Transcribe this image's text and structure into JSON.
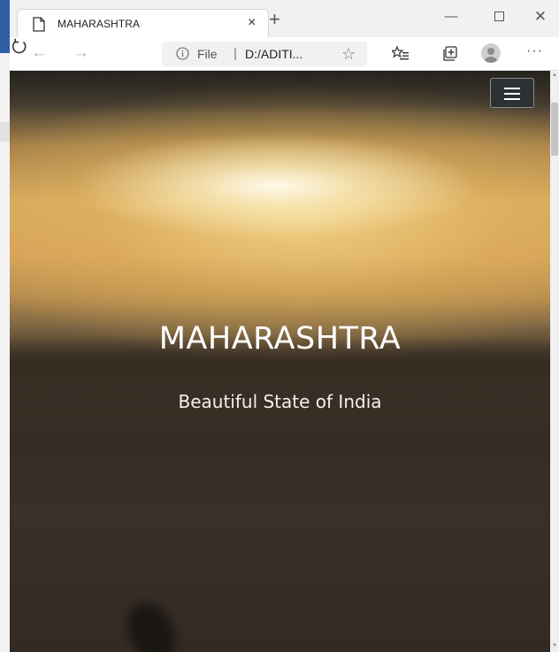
{
  "window": {
    "tab_title": "MAHARASHTRA",
    "close_tab_glyph": "×",
    "new_tab_glyph": "+",
    "minimize_glyph": "—",
    "close_window_glyph": "✕"
  },
  "addressbar": {
    "back_glyph": "←",
    "forward_glyph": "→",
    "url_scheme": "File",
    "url_separator": "|",
    "url_text": "D:/ADITI...",
    "favorite_glyph": "☆",
    "more_glyph": "···"
  },
  "hero": {
    "title": "MAHARASHTRA",
    "subtitle": "Beautiful State of India"
  },
  "icons": {
    "page": "page-icon",
    "refresh": "refresh-icon",
    "info": "info-icon",
    "favorites_list": "favorites-list-icon",
    "collections": "collections-icon",
    "profile": "profile-icon",
    "menu": "hamburger-menu-icon"
  },
  "colors": {
    "navbar_toggle_bg": "#2e3134",
    "hero_text": "#ffffff",
    "sky_highlight": "#fff6d8",
    "ground_dark": "#332a24"
  }
}
